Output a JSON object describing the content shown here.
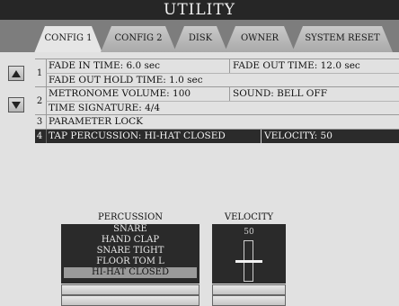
{
  "window": {
    "title": "UTILITY"
  },
  "tabs": [
    {
      "label": "CONFIG 1",
      "active": true
    },
    {
      "label": "CONFIG 2",
      "active": false
    },
    {
      "label": "DISK",
      "active": false
    },
    {
      "label": "OWNER",
      "active": false
    },
    {
      "label": "SYSTEM RESET",
      "active": false
    }
  ],
  "nav": {
    "up_icon": "triangle-up-icon",
    "down_icon": "triangle-down-icon"
  },
  "settings": {
    "group1": {
      "num": "1",
      "fade_in": "FADE IN TIME:   6.0 sec",
      "fade_out": "FADE OUT TIME:  12.0 sec",
      "fade_out_hold": "FADE OUT HOLD TIME:  1.0 sec"
    },
    "group2": {
      "num": "2",
      "metronome_volume": "METRONOME VOLUME:  100",
      "sound": "SOUND:  BELL OFF",
      "time_signature": "TIME SIGNATURE:     4/4"
    },
    "group3": {
      "num": "3",
      "parameter_lock": "PARAMETER LOCK"
    },
    "group4": {
      "num": "4",
      "tap_percussion": "TAP PERCUSSION:  HI-HAT CLOSED",
      "velocity": "VELOCITY:  50"
    }
  },
  "percussion": {
    "label": "PERCUSSION",
    "items": [
      "SNARE",
      "HAND CLAP",
      "SNARE TIGHT",
      "FLOOR TOM  L",
      "HI-HAT CLOSED"
    ],
    "selected": "HI-HAT CLOSED"
  },
  "velocity": {
    "label": "VELOCITY",
    "value": "50"
  },
  "colors": {
    "title_bg": "#262626",
    "selected_row_bg": "#2b2b2b",
    "panel_bg": "#e1e1e1"
  }
}
